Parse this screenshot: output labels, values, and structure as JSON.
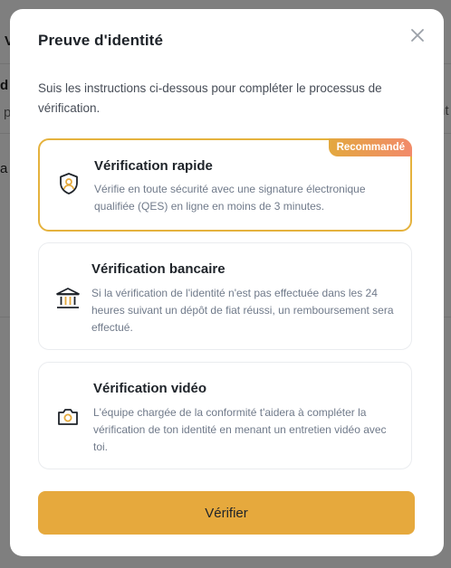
{
  "background": {
    "fragments": [
      "V",
      "d",
      "p",
      "a",
      "nt"
    ]
  },
  "modal": {
    "title": "Preuve d'identité",
    "intro": "Suis les instructions ci-dessous pour compléter le processus de vérification.",
    "options": [
      {
        "title": "Vérification rapide",
        "description": "Vérifie en toute sécurité avec une signature électronique qualifiée (QES) en ligne en moins de 3 minutes.",
        "badge": "Recommandé",
        "icon": "shield-user-icon",
        "selected": true
      },
      {
        "title": "Vérification bancaire",
        "description": "Si la vérification de l'identité n'est pas effectuée dans les 24 heures suivant un dépôt de fiat réussi, un remboursement sera effectué.",
        "icon": "bank-icon",
        "selected": false
      },
      {
        "title": "Vérification vidéo",
        "description": "L'équipe chargée de la conformité t'aidera à compléter la vérification de ton identité en menant un entretien vidéo avec toi.",
        "icon": "camera-icon",
        "selected": false
      }
    ],
    "submit_label": "Vérifier"
  },
  "colors": {
    "accent": "#e6a93d",
    "badge_gradient_start": "#e3a83e",
    "badge_gradient_end": "#f28a6b",
    "text_primary": "#1e2329",
    "text_secondary": "#707a8a"
  }
}
